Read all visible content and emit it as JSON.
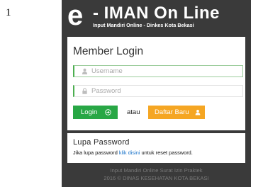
{
  "figure_number": "1",
  "header": {
    "logo_letter": "e",
    "title": "- IMAN On Line",
    "subtitle": "Input Mandiri Online - Dinkes Kota Bekasi"
  },
  "login": {
    "heading": "Member Login",
    "username_placeholder": "Username",
    "password_placeholder": "Password",
    "login_button": "Login",
    "or_text": "atau",
    "register_button": "Daftar Baru"
  },
  "forgot": {
    "heading": "Lupa Password",
    "text_before": "Jika lupa password ",
    "link": "klik disini",
    "text_after": " untuk reset password."
  },
  "footer": {
    "line1": "Input Mandiri Online Surat Izin Praktek",
    "line2": "2016 © DINAS KESEHATAN KOTA BEKASI"
  },
  "colors": {
    "panel_bg": "#3a3a3a",
    "login_green": "#28a745",
    "register_orange": "#f5a623",
    "link_blue": "#1a73c9"
  },
  "icons": {
    "username": "user-icon",
    "password": "lock-icon",
    "login": "arrow-circle-right-icon",
    "register": "user-icon"
  }
}
